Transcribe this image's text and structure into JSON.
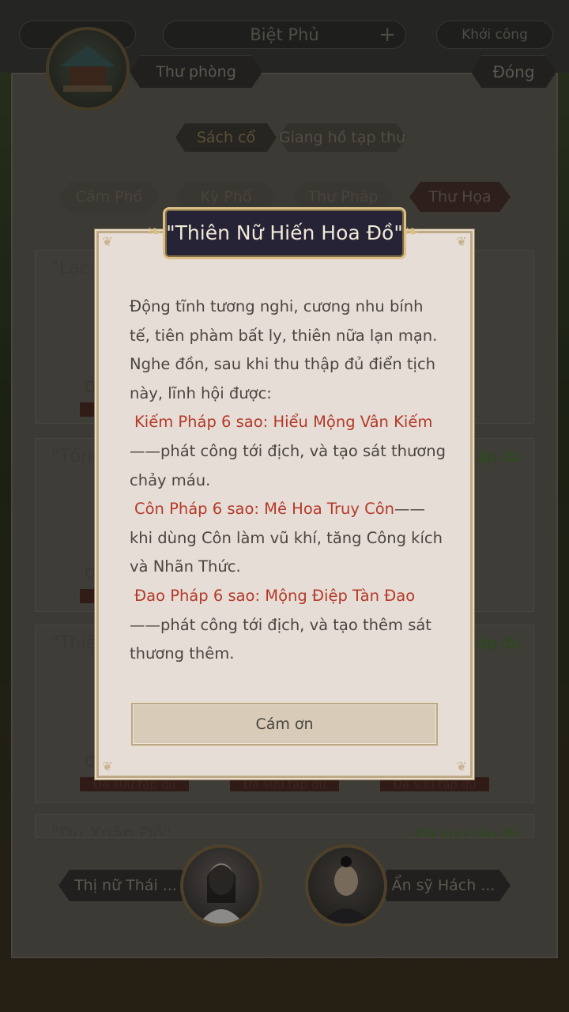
{
  "header": {
    "title": "Biệt Phủ",
    "left_pill": "",
    "right_pill": "Khởi công",
    "room_label": "Thư phòng",
    "room_info": "",
    "close_label": "Đóng"
  },
  "collection_tabs": [
    "Sách cổ",
    "Giang hồ tạp thư"
  ],
  "category_tabs": [
    "Cầm Phổ",
    "Kỳ Phổ",
    "Thư Pháp",
    "Thư Họa"
  ],
  "list": {
    "items": [
      {
        "title": "\"Lạc T",
        "status": ""
      },
      {
        "title": "\"Tống",
        "status": "tập đủ"
      },
      {
        "title": "\"Thiê",
        "status": "tập đủ"
      },
      {
        "title": "\"Du Xuân Đồ\"",
        "status": "Đã sưu tập đủ"
      }
    ],
    "row_label": "Q",
    "bar_label": "Đã sưu tập đủ"
  },
  "characters": [
    {
      "name": "Thị nữ Thái ..."
    },
    {
      "name": "Ẩn sỹ Hách ..."
    }
  ],
  "modal": {
    "title": "\"Thiên Nữ Hiến Hoa Đồ\"",
    "intro": "Động tĩnh tương nghi, cương nhu bính tế, tiên phàm bất ly, thiên nữa lạn mạn. Nghe đồn, sau khi thu thập đủ điển tịch này, lĩnh hội được:",
    "skills": [
      {
        "name": "Kiếm Pháp 6 sao: Hiểu Mộng Vân Kiếm",
        "desc": "——phát công tới địch, và tạo sát thương chảy máu."
      },
      {
        "name": "Côn Pháp 6 sao: Mê Hoa Truy Côn",
        "desc": "——khi dùng Côn làm vũ khí, tăng Công kích và Nhãn Thức."
      },
      {
        "name": "Đao Pháp 6 sao: Mộng Điệp Tàn Đao",
        "desc": "——phát công tới địch, và tạo thêm sát thương thêm."
      }
    ],
    "confirm_label": "Cám ơn"
  },
  "colors": {
    "modal_bg": "#e7ddd7",
    "title_bg": "#252335",
    "skill_red": "#b33a28",
    "gold_border": "#d9c089"
  }
}
